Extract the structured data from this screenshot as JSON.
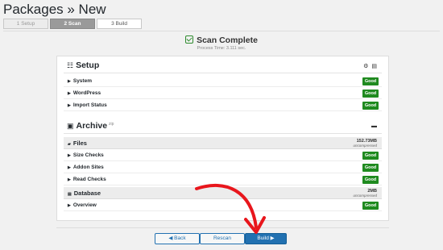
{
  "header": {
    "title": "Packages » New"
  },
  "steps": [
    {
      "label": "1 Setup"
    },
    {
      "label": "2 Scan"
    },
    {
      "label": "3 Build"
    }
  ],
  "scan": {
    "title": "Scan Complete",
    "process_time": "Process Time: 3.111 sec."
  },
  "setup": {
    "title": "Setup",
    "rows": [
      {
        "label": "System",
        "status": "Good"
      },
      {
        "label": "WordPress",
        "status": "Good"
      },
      {
        "label": "Import Status",
        "status": "Good"
      }
    ]
  },
  "archive": {
    "title": "Archive",
    "superscript": "zip",
    "files": {
      "label": "Files",
      "size": "152.73MB",
      "note": "uncompressed"
    },
    "file_rows": [
      {
        "label": "Size Checks",
        "status": "Good"
      },
      {
        "label": "Addon Sites",
        "status": "Good"
      },
      {
        "label": "Read Checks",
        "status": "Good"
      }
    ],
    "database": {
      "label": "Database",
      "size": "2MB",
      "note": "uncompressed"
    },
    "db_rows": [
      {
        "label": "Overview",
        "status": "Good"
      }
    ]
  },
  "footer": {
    "back": "◀ Back",
    "rescan": "Rescan",
    "build": "Build ▶"
  },
  "colors": {
    "good": "#1f8a1f",
    "primary": "#2271b1",
    "arrow": "#e8161c"
  }
}
